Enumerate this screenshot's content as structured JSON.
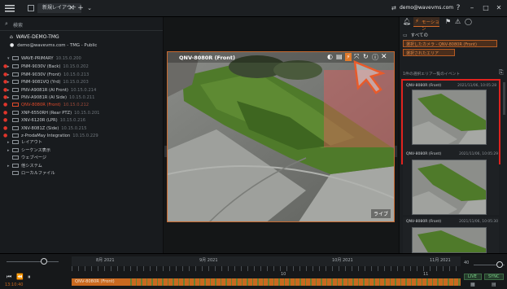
{
  "titlebar": {
    "tab_label": "新規レイアウト",
    "user": "demo@wavevms.com",
    "help": "?",
    "minimize": "–",
    "maximize": "□",
    "close": "✕"
  },
  "left": {
    "search_placeholder": "検索",
    "server_name": "WAVE-DEMO-TMG",
    "user_line": "demo@wavevms.com - TMG - Public",
    "tree": [
      {
        "label": "WAVE-PRIMARY",
        "ip": "10.15.0.200",
        "depth": 0,
        "expand": "▾",
        "rec": false,
        "sel": false
      },
      {
        "label": "PNM-9030V (Back)",
        "ip": "10.15.0.202",
        "depth": 1,
        "expand": "▸",
        "rec": true,
        "sel": false
      },
      {
        "label": "PNM-9030V (Front)",
        "ip": "10.15.0.213",
        "depth": 1,
        "expand": "▸",
        "rec": true,
        "sel": false
      },
      {
        "label": "PNM-9081VQ (Yrd)",
        "ip": "10.15.0.203",
        "depth": 1,
        "expand": "▸",
        "rec": true,
        "sel": false
      },
      {
        "label": "PNV-A9081R (AI Front)",
        "ip": "10.15.0.214",
        "depth": 1,
        "expand": "▸",
        "rec": true,
        "sel": false
      },
      {
        "label": "PNV-A9081R (AI Side)",
        "ip": "10.15.0.211",
        "depth": 1,
        "expand": "▸",
        "rec": true,
        "sel": false
      },
      {
        "label": "QNV-8080R (Front)",
        "ip": "10.15.0.212",
        "depth": 1,
        "expand": "",
        "rec": true,
        "sel": true
      },
      {
        "label": "XNP-6550RH (Rear PTZ)",
        "ip": "10.15.0.201",
        "depth": 1,
        "expand": "",
        "rec": true,
        "sel": false
      },
      {
        "label": "XNV-6120R (LPR)",
        "ip": "10.15.0.216",
        "depth": 1,
        "expand": "",
        "rec": true,
        "sel": false
      },
      {
        "label": "XNV-8081Z (Side)",
        "ip": "10.15.0.215",
        "depth": 1,
        "expand": "",
        "rec": true,
        "sel": false
      },
      {
        "label": "z-ProdaMay Integration",
        "ip": "10.15.0.229",
        "depth": 1,
        "expand": "",
        "rec": true,
        "sel": false
      },
      {
        "label": "レイアウト",
        "ip": "",
        "depth": 0,
        "expand": "▸",
        "rec": false,
        "sel": false
      },
      {
        "label": "シーケンス表示",
        "ip": "",
        "depth": 0,
        "expand": "▸",
        "rec": false,
        "sel": false
      },
      {
        "label": "ウェブページ",
        "ip": "",
        "depth": 0,
        "expand": "",
        "rec": false,
        "sel": false
      },
      {
        "label": "他システム",
        "ip": "",
        "depth": 0,
        "expand": "▸",
        "rec": false,
        "sel": false
      },
      {
        "label": "ローカルファイル",
        "ip": "",
        "depth": 0,
        "expand": "",
        "rec": false,
        "sel": false
      }
    ]
  },
  "camera": {
    "title": "QNV-8080R (Front)",
    "live_label": "ライブ"
  },
  "right": {
    "tab_label": "モーション",
    "category": "すべての",
    "filter_camera": "選択したカメラ - QNV-8080R (Front)",
    "filter_area": "選択されたエリア",
    "section_label": "1件の選択エリア一覧のイベント",
    "events": [
      {
        "camera": "QNV-8080R (Front)",
        "time": "2021/11/06, 10:05:28"
      },
      {
        "camera": "QNV-8080R (Front)",
        "time": "2021/11/06, 10:05:29"
      },
      {
        "camera": "QNV-8080R (Front)",
        "time": "2021/11/06, 10:05:30"
      }
    ]
  },
  "timeline": {
    "dates": [
      "8月 2021",
      "9月 2021",
      "10月 2021",
      "11月 2021"
    ],
    "ticks": [
      "10",
      "11"
    ],
    "camera_label": "QNV-8080R (Front)",
    "time_readout": "13:10:40",
    "live_btn": "LIVE",
    "sync_btn": "SYNC",
    "zoom_value": "40"
  }
}
